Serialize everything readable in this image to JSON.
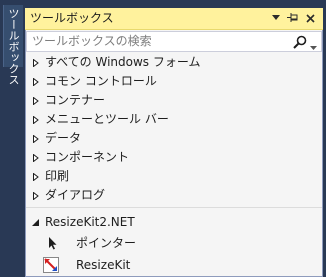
{
  "sidebar": {
    "tab_label": "ツールボックス"
  },
  "toolbox": {
    "title": "ツールボックス",
    "title_icons": [
      "pin-dropdown-icon",
      "auto-hide-pin-icon",
      "close-icon"
    ],
    "search_placeholder": "ツールボックスの検索",
    "categories": [
      {
        "label": "すべての Windows フォーム"
      },
      {
        "label": "コモン コントロール"
      },
      {
        "label": "コンテナー"
      },
      {
        "label": "メニューとツール バー"
      },
      {
        "label": "データ"
      },
      {
        "label": "コンポーネント"
      },
      {
        "label": "印刷"
      },
      {
        "label": "ダイアログ"
      }
    ],
    "expanded_category": "ResizeKit2.NET",
    "items": [
      {
        "label": "ポインター",
        "icon": "pointer-arrow-icon"
      },
      {
        "label": "ResizeKit",
        "icon": "resizekit-icon"
      }
    ]
  },
  "colors": {
    "background": "#293955",
    "title_bar": "#fff29d",
    "panel": "#f5f5f5"
  }
}
